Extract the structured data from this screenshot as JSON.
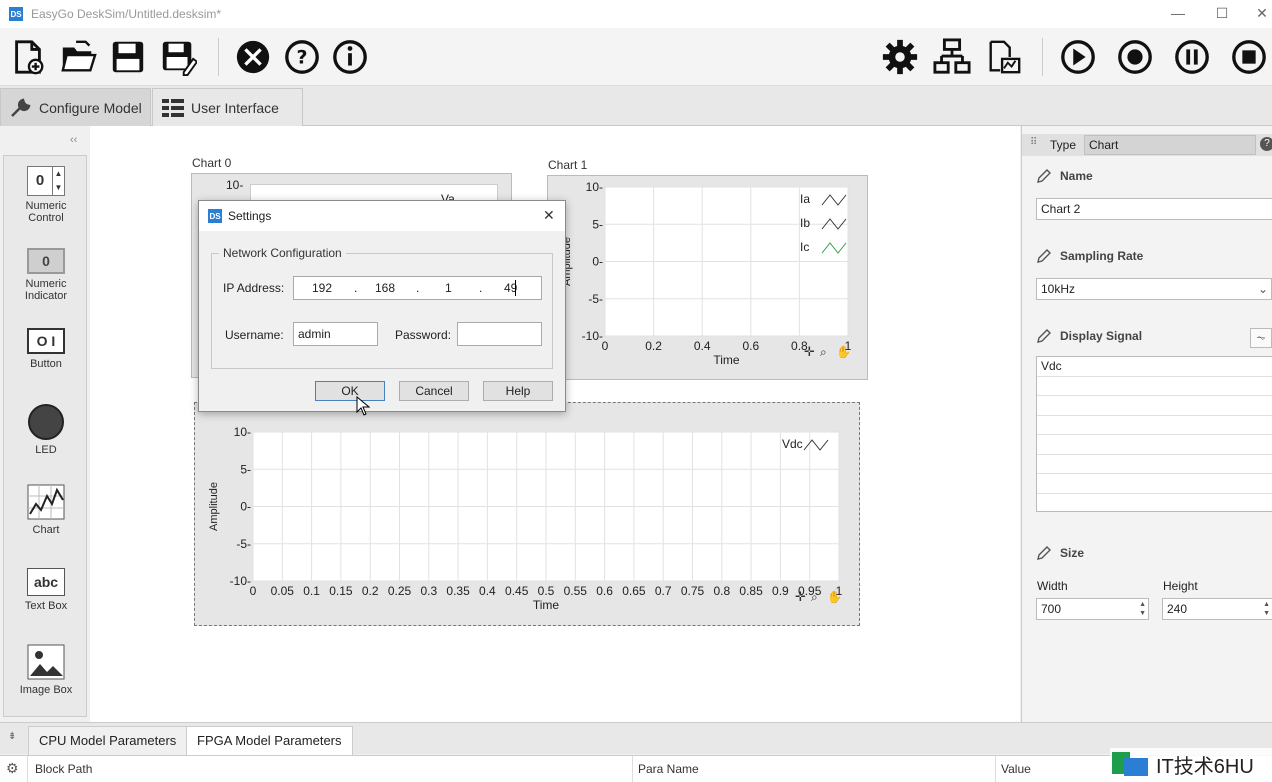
{
  "window": {
    "title": "EasyGo DeskSim/Untitled.desksim*",
    "app_icon": "DS",
    "minimize": "—",
    "maximize": "☐",
    "close": "✕"
  },
  "main_tabs": [
    {
      "label": "Configure Model"
    },
    {
      "label": "User Interface"
    }
  ],
  "palette": {
    "collapse": "‹‹",
    "items": [
      {
        "label": "Numeric\nControl",
        "icon": "numeric-control-icon",
        "glyph": "0"
      },
      {
        "label": "Numeric\nIndicator",
        "icon": "numeric-indicator-icon",
        "glyph": "0"
      },
      {
        "label": "Button",
        "icon": "button-icon",
        "glyph": "O I"
      },
      {
        "label": "LED",
        "icon": "led-icon"
      },
      {
        "label": "Chart",
        "icon": "chart-icon"
      },
      {
        "label": "Text Box",
        "icon": "text-box-icon",
        "glyph": "abc"
      },
      {
        "label": "Image Box",
        "icon": "image-box-icon"
      }
    ]
  },
  "charts": {
    "chart0": {
      "label": "Chart 0",
      "ytick_top": "10-",
      "legend_partial": "Va"
    },
    "chart1": {
      "label": "Chart 1",
      "yticks": [
        "10-",
        "5-",
        "0-",
        "-5-",
        "-10-"
      ],
      "xticks": [
        "0",
        "0.2",
        "0.4",
        "0.6",
        "0.8",
        "1"
      ],
      "xlabel": "Time",
      "ylabel": "Amplitude",
      "legend": [
        {
          "name": "Ia",
          "color": "#333333"
        },
        {
          "name": "Ib",
          "color": "#333333"
        },
        {
          "name": "Ic",
          "color": "#2e9e44"
        }
      ]
    },
    "chart2": {
      "yticks": [
        "10-",
        "5-",
        "0-",
        "-5-",
        "-10-"
      ],
      "xticks": [
        "0",
        "0.05",
        "0.1",
        "0.15",
        "0.2",
        "0.25",
        "0.3",
        "0.35",
        "0.4",
        "0.45",
        "0.5",
        "0.55",
        "0.6",
        "0.65",
        "0.7",
        "0.75",
        "0.8",
        "0.85",
        "0.9",
        "0.95",
        "1"
      ],
      "xlabel": "Time",
      "ylabel": "Amplitude",
      "legend": [
        {
          "name": "Vdc",
          "color": "#333333"
        }
      ]
    }
  },
  "dialog": {
    "title": "Settings",
    "group": "Network Configuration",
    "ip_label": "IP Address:",
    "ip": [
      "192",
      "168",
      "1",
      "49"
    ],
    "ip_dot": ".",
    "username_label": "Username:",
    "username": "admin",
    "password_label": "Password:",
    "password": "",
    "ok": "OK",
    "cancel": "Cancel",
    "help": "Help",
    "close": "✕"
  },
  "properties": {
    "type_label": "Type",
    "type_value": "Chart",
    "name_label": "Name",
    "name_value": "Chart 2",
    "sampling_label": "Sampling Rate",
    "sampling_value": "10kHz",
    "display_label": "Display Signal",
    "signals": [
      "Vdc",
      "",
      "",
      "",
      "",
      "",
      ""
    ],
    "size_label": "Size",
    "width_label": "Width",
    "width_value": "700",
    "height_label": "Height",
    "height_value": "240"
  },
  "bottom": {
    "tabs": [
      {
        "label": "CPU Model Parameters"
      },
      {
        "label": "FPGA Model Parameters"
      }
    ],
    "columns": [
      "Block Path",
      "Para Name",
      "Value"
    ]
  },
  "watermark": "IT技术6HU"
}
